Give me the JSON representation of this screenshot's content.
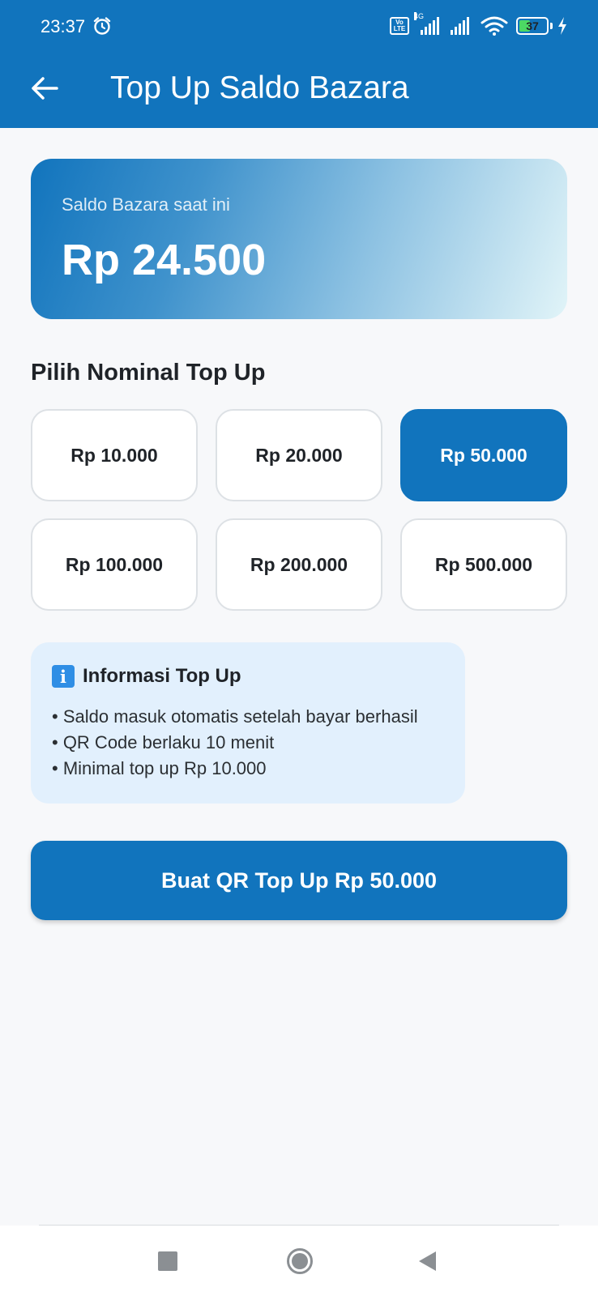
{
  "status_bar": {
    "time": "23:37",
    "network": "4G",
    "volte": "Vo LTE",
    "battery": "37",
    "icons": [
      "alarm-icon",
      "signal-icon",
      "wifi-icon",
      "battery-icon",
      "charging-icon"
    ]
  },
  "app_bar": {
    "title": "Top Up Saldo Bazara",
    "back_icon": "arrow-left-icon",
    "color": "#1174bd"
  },
  "balance": {
    "label": "Saldo Bazara saat ini",
    "value": "Rp 24.500"
  },
  "nominal": {
    "title": "Pilih Nominal Top Up",
    "options": [
      {
        "label": "Rp 10.000",
        "selected": false
      },
      {
        "label": "Rp 20.000",
        "selected": false
      },
      {
        "label": "Rp 50.000",
        "selected": true
      },
      {
        "label": "Rp 100.000",
        "selected": false
      },
      {
        "label": "Rp 200.000",
        "selected": false
      },
      {
        "label": "Rp 500.000",
        "selected": false
      }
    ]
  },
  "info": {
    "icon": "info-icon",
    "icon_glyph": "i",
    "title": "Informasi Top Up",
    "items": [
      "• Saldo masuk otomatis setelah bayar berhasil",
      "• QR Code berlaku 10 menit",
      "• Minimal top up Rp 10.000"
    ]
  },
  "action": {
    "label": "Buat QR Top Up Rp 50.000"
  },
  "nav_bar": {
    "icons": [
      "recent-apps-icon",
      "home-icon",
      "back-triangle-icon"
    ]
  },
  "colors": {
    "primary": "#1174bd",
    "info_bg": "#e2f0fd",
    "page_bg": "#f7f8fa"
  }
}
